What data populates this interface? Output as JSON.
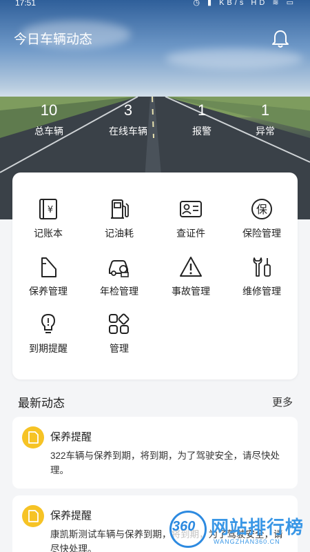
{
  "status_bar": {
    "time": "17:51",
    "icons": "◷ ▮ KB/s HD ≋ ▭"
  },
  "header": {
    "title": "今日车辆动态",
    "bell_icon": "bell-icon"
  },
  "stats": [
    {
      "value": "10",
      "label": "总车辆"
    },
    {
      "value": "3",
      "label": "在线车辆"
    },
    {
      "value": "1",
      "label": "报警"
    },
    {
      "value": "1",
      "label": "异常"
    }
  ],
  "grid": {
    "items": [
      {
        "label": "记账本",
        "icon": "ledger-icon"
      },
      {
        "label": "记油耗",
        "icon": "fuel-pump-icon"
      },
      {
        "label": "查证件",
        "icon": "id-card-icon"
      },
      {
        "label": "保险管理",
        "icon": "insurance-icon"
      },
      {
        "label": "保养管理",
        "icon": "oil-can-icon"
      },
      {
        "label": "年检管理",
        "icon": "car-inspection-icon"
      },
      {
        "label": "事故管理",
        "icon": "warning-icon"
      },
      {
        "label": "维修管理",
        "icon": "wrench-icon"
      },
      {
        "label": "到期提醒",
        "icon": "bulb-icon"
      },
      {
        "label": "管理",
        "icon": "apps-icon"
      }
    ]
  },
  "news": {
    "section_title": "最新动态",
    "more_label": "更多",
    "items": [
      {
        "title": "保养提醒",
        "text": "322车辆与保养到期，将到期，为了驾驶安全，请尽快处理。"
      },
      {
        "title": "保养提醒",
        "text": "康凯斯测试车辆与保养到期，将到期，为了驾驶安全，请尽快处理。"
      }
    ]
  },
  "watermark": {
    "logo_text": "360",
    "brand": "网站排行榜",
    "url": "WANGZHAN360.CN"
  },
  "colors": {
    "accent_yellow": "#f6c325",
    "watermark_blue": "#3a97e6"
  }
}
